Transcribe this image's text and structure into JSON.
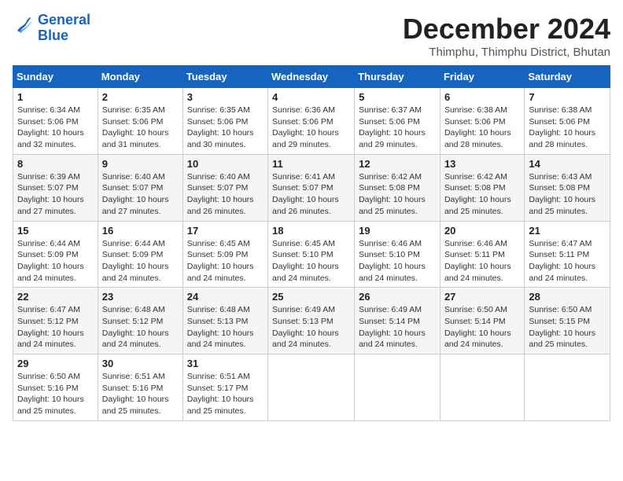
{
  "logo": {
    "line1": "General",
    "line2": "Blue"
  },
  "title": "December 2024",
  "location": "Thimphu, Thimphu District, Bhutan",
  "days_of_week": [
    "Sunday",
    "Monday",
    "Tuesday",
    "Wednesday",
    "Thursday",
    "Friday",
    "Saturday"
  ],
  "weeks": [
    [
      {
        "day": "1",
        "sunrise": "6:34 AM",
        "sunset": "5:06 PM",
        "daylight": "10 hours and 32 minutes."
      },
      {
        "day": "2",
        "sunrise": "6:35 AM",
        "sunset": "5:06 PM",
        "daylight": "10 hours and 31 minutes."
      },
      {
        "day": "3",
        "sunrise": "6:35 AM",
        "sunset": "5:06 PM",
        "daylight": "10 hours and 30 minutes."
      },
      {
        "day": "4",
        "sunrise": "6:36 AM",
        "sunset": "5:06 PM",
        "daylight": "10 hours and 29 minutes."
      },
      {
        "day": "5",
        "sunrise": "6:37 AM",
        "sunset": "5:06 PM",
        "daylight": "10 hours and 29 minutes."
      },
      {
        "day": "6",
        "sunrise": "6:38 AM",
        "sunset": "5:06 PM",
        "daylight": "10 hours and 28 minutes."
      },
      {
        "day": "7",
        "sunrise": "6:38 AM",
        "sunset": "5:06 PM",
        "daylight": "10 hours and 28 minutes."
      }
    ],
    [
      {
        "day": "8",
        "sunrise": "6:39 AM",
        "sunset": "5:07 PM",
        "daylight": "10 hours and 27 minutes."
      },
      {
        "day": "9",
        "sunrise": "6:40 AM",
        "sunset": "5:07 PM",
        "daylight": "10 hours and 27 minutes."
      },
      {
        "day": "10",
        "sunrise": "6:40 AM",
        "sunset": "5:07 PM",
        "daylight": "10 hours and 26 minutes."
      },
      {
        "day": "11",
        "sunrise": "6:41 AM",
        "sunset": "5:07 PM",
        "daylight": "10 hours and 26 minutes."
      },
      {
        "day": "12",
        "sunrise": "6:42 AM",
        "sunset": "5:08 PM",
        "daylight": "10 hours and 25 minutes."
      },
      {
        "day": "13",
        "sunrise": "6:42 AM",
        "sunset": "5:08 PM",
        "daylight": "10 hours and 25 minutes."
      },
      {
        "day": "14",
        "sunrise": "6:43 AM",
        "sunset": "5:08 PM",
        "daylight": "10 hours and 25 minutes."
      }
    ],
    [
      {
        "day": "15",
        "sunrise": "6:44 AM",
        "sunset": "5:09 PM",
        "daylight": "10 hours and 24 minutes."
      },
      {
        "day": "16",
        "sunrise": "6:44 AM",
        "sunset": "5:09 PM",
        "daylight": "10 hours and 24 minutes."
      },
      {
        "day": "17",
        "sunrise": "6:45 AM",
        "sunset": "5:09 PM",
        "daylight": "10 hours and 24 minutes."
      },
      {
        "day": "18",
        "sunrise": "6:45 AM",
        "sunset": "5:10 PM",
        "daylight": "10 hours and 24 minutes."
      },
      {
        "day": "19",
        "sunrise": "6:46 AM",
        "sunset": "5:10 PM",
        "daylight": "10 hours and 24 minutes."
      },
      {
        "day": "20",
        "sunrise": "6:46 AM",
        "sunset": "5:11 PM",
        "daylight": "10 hours and 24 minutes."
      },
      {
        "day": "21",
        "sunrise": "6:47 AM",
        "sunset": "5:11 PM",
        "daylight": "10 hours and 24 minutes."
      }
    ],
    [
      {
        "day": "22",
        "sunrise": "6:47 AM",
        "sunset": "5:12 PM",
        "daylight": "10 hours and 24 minutes."
      },
      {
        "day": "23",
        "sunrise": "6:48 AM",
        "sunset": "5:12 PM",
        "daylight": "10 hours and 24 minutes."
      },
      {
        "day": "24",
        "sunrise": "6:48 AM",
        "sunset": "5:13 PM",
        "daylight": "10 hours and 24 minutes."
      },
      {
        "day": "25",
        "sunrise": "6:49 AM",
        "sunset": "5:13 PM",
        "daylight": "10 hours and 24 minutes."
      },
      {
        "day": "26",
        "sunrise": "6:49 AM",
        "sunset": "5:14 PM",
        "daylight": "10 hours and 24 minutes."
      },
      {
        "day": "27",
        "sunrise": "6:50 AM",
        "sunset": "5:14 PM",
        "daylight": "10 hours and 24 minutes."
      },
      {
        "day": "28",
        "sunrise": "6:50 AM",
        "sunset": "5:15 PM",
        "daylight": "10 hours and 25 minutes."
      }
    ],
    [
      {
        "day": "29",
        "sunrise": "6:50 AM",
        "sunset": "5:16 PM",
        "daylight": "10 hours and 25 minutes."
      },
      {
        "day": "30",
        "sunrise": "6:51 AM",
        "sunset": "5:16 PM",
        "daylight": "10 hours and 25 minutes."
      },
      {
        "day": "31",
        "sunrise": "6:51 AM",
        "sunset": "5:17 PM",
        "daylight": "10 hours and 25 minutes."
      },
      null,
      null,
      null,
      null
    ]
  ],
  "labels": {
    "sunrise": "Sunrise:",
    "sunset": "Sunset:",
    "daylight": "Daylight:"
  }
}
